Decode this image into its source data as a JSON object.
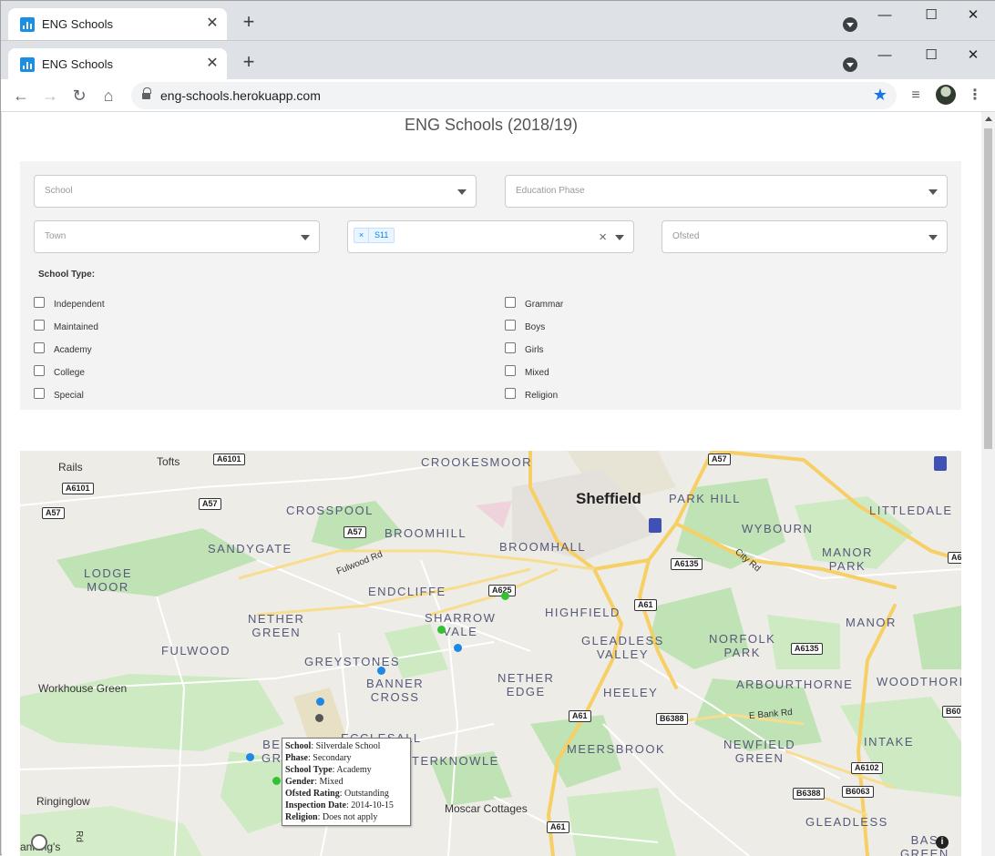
{
  "browser": {
    "tab_title_back": "ENG Schools",
    "tab_title_front": "ENG Schools",
    "url": "eng-schools.herokuapp.com"
  },
  "page": {
    "title": "ENG Schools (2018/19)"
  },
  "filters": {
    "school_placeholder": "School",
    "phase_placeholder": "Education Phase",
    "town_placeholder": "Town",
    "postcode_chip_remove": "×",
    "postcode_chip_value": "S11",
    "ofsted_placeholder": "Ofsted",
    "school_type_label": "School Type:",
    "checkboxes_left": [
      "Independent",
      "Maintained",
      "Academy",
      "College",
      "Special"
    ],
    "checkboxes_right": [
      "Grammar",
      "Boys",
      "Girls",
      "Mixed",
      "Religion"
    ]
  },
  "map": {
    "places": {
      "rails": "Rails",
      "tofts": "Tofts",
      "crookesmoor": "CROOKESMOOR",
      "sheffield": "Sheffield",
      "park_hill": "PARK HILL",
      "littledale": "LITTLEDALE",
      "crosspool": "CROSSPOOL",
      "broomhill": "BROOMHILL",
      "sandygate": "SANDYGATE",
      "broomhall": "BROOMHALL",
      "wybourn": "WYBOURN",
      "manor_park": "MANOR\nPARK",
      "lodge_moor": "LODGE\nMOOR",
      "endcliffe": "ENDCLIFFE",
      "highfield": "HIGHFIELD",
      "sharrow_vale": "SHARROW\nVALE",
      "nether_green": "NETHER\nGREEN",
      "gleadless_valley": "GLEADLESS\nVALLEY",
      "norfolk_park": "NORFOLK\nPARK",
      "manor": "MANOR",
      "fulwood": "FULWOOD",
      "greystones": "GREYSTONES",
      "banner_cross": "BANNER\nCROSS",
      "nether_edge": "NETHER\nEDGE",
      "arbourthorne": "ARBOURTHORNE",
      "woodthorpe": "WOODTHORP",
      "workhouse_green": "Workhouse Green",
      "heeley": "HEELEY",
      "ecclesall": "ECCLESALL",
      "meersbrook": "MEERSBROOK",
      "intake": "INTAKE",
      "bents_green": "BE\nGR",
      "newfield_green": "NEWFIELD\nGREEN",
      "terknowle": "TERKNOWLE",
      "ringinglow": "Ringinglow",
      "moscar_cottages": "Moscar Cottages",
      "gleadless": "GLEADLESS",
      "base_green": "BAS\nGREEN",
      "ganning": "anning's"
    },
    "shields": {
      "a6101_top": "A6101",
      "a6101_left": "A6101",
      "a57_top": "A57",
      "a57_left": "A57",
      "a57_mid": "A57",
      "a57_right": "A57",
      "a625": "A625",
      "a6135_top": "A6135",
      "a61_mid": "A61",
      "a6135_right": "A6135",
      "a61_low": "A61",
      "b6388_mid": "B6388",
      "a6102": "A6102",
      "b6388_low": "B6388",
      "b6063": "B6063",
      "a61_bottom": "A61",
      "a6_edge": "A6",
      "b60_edge": "B60"
    },
    "road_labels": {
      "fulwood_rd": "Fulwood Rd",
      "city_rd": "City Rd",
      "e_bank_rd": "E Bank Rd",
      "rd_vertical": "Rd"
    },
    "tooltip": {
      "school_k": "School",
      "school_v": "Silverdale School",
      "phase_k": "Phase",
      "phase_v": "Secondary",
      "type_k": "School Type",
      "type_v": "Academy",
      "gender_k": "Gender",
      "gender_v": "Mixed",
      "ofsted_k": "Ofsted Rating",
      "ofsted_v": "Outstanding",
      "insp_k": "Inspection Date",
      "insp_v": "2014-10-15",
      "religion_k": "Religion",
      "religion_v": "Does not apply"
    },
    "marker_colors": {
      "blue": "#1e88e5",
      "green": "#34c134",
      "grey": "#555555"
    },
    "info_icon": "i"
  }
}
